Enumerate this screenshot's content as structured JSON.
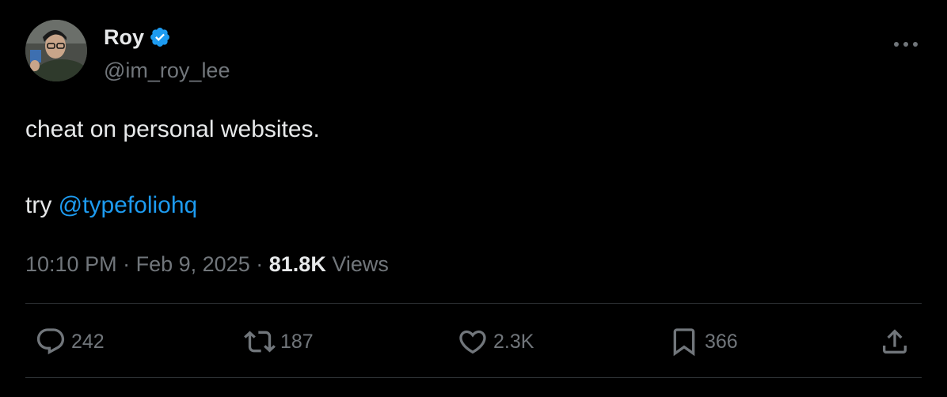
{
  "author": {
    "name": "Roy",
    "handle": "@im_roy_lee",
    "verified": true
  },
  "tweet": {
    "line1": "cheat on personal websites.",
    "line2_prefix": "try",
    "mention": "@typefoliohq",
    "time": "10:10 PM",
    "date": "Feb 9, 2025",
    "separator": "·",
    "views_count": "81.8K",
    "views_label": "Views"
  },
  "actions": {
    "replies": "242",
    "reposts": "187",
    "likes": "2.3K",
    "bookmarks": "366"
  },
  "colors": {
    "background": "#000000",
    "text": "#e7e9ea",
    "muted": "#71767b",
    "link": "#1d9bf0",
    "verified": "#1d9bf0",
    "divider": "#2f3336"
  },
  "icons": [
    "verified-badge-icon",
    "more-icon",
    "reply-icon",
    "repost-icon",
    "like-icon",
    "bookmark-icon",
    "share-icon"
  ]
}
